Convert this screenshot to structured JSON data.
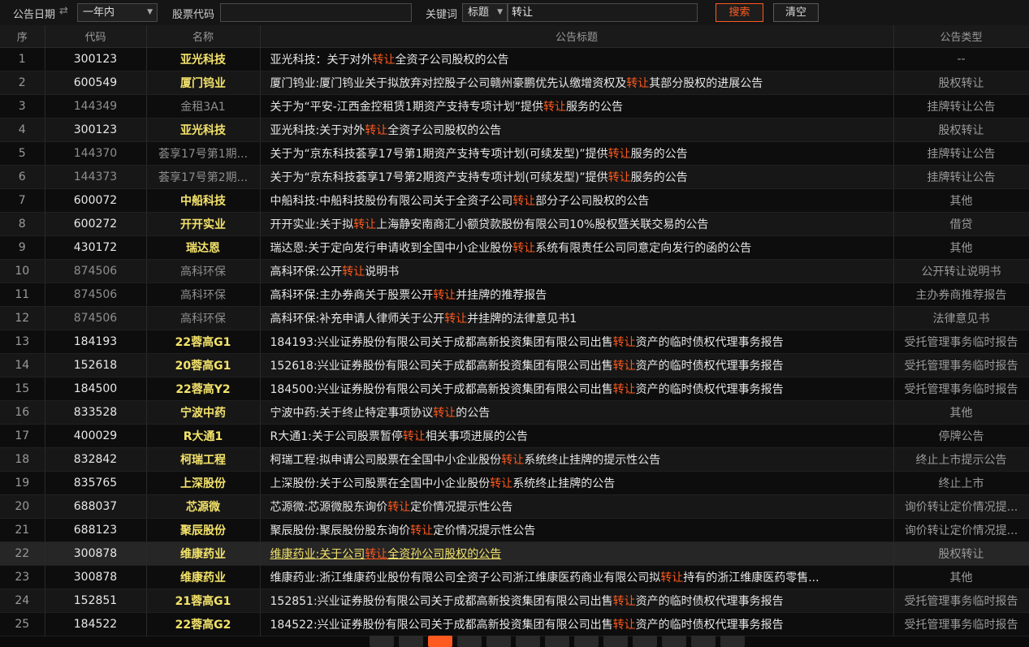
{
  "toolbar": {
    "date_label": "公告日期",
    "date_range": "一年内",
    "stock_code_label": "股票代码",
    "stock_code_value": "",
    "keyword_label": "关键词",
    "keyword_field": "标题",
    "keyword_value": "转让",
    "search_label": "搜索",
    "clear_label": "清空"
  },
  "columns": [
    "序",
    "代码",
    "名称",
    "公告标题",
    "公告类型"
  ],
  "rows": [
    {
      "idx": "1",
      "code": "300123",
      "name": "亚光科技",
      "pre": "亚光科技：关于对外",
      "hl": "转让",
      "post": "全资子公司股权的公告",
      "type": "--",
      "dim": false
    },
    {
      "idx": "2",
      "code": "600549",
      "name": "厦门钨业",
      "pre": "厦门钨业:厦门钨业关于拟放弃对控股子公司赣州豪鹏优先认缴增资权及",
      "hl": "转让",
      "post": "其部分股权的进展公告",
      "type": "股权转让",
      "dim": false
    },
    {
      "idx": "3",
      "code": "144349",
      "name": "金租3A1",
      "pre": "关于为“平安-江西金控租赁1期资产支持专项计划”提供",
      "hl": "转让",
      "post": "服务的公告",
      "type": "挂牌转让公告",
      "dim": true
    },
    {
      "idx": "4",
      "code": "300123",
      "name": "亚光科技",
      "pre": "亚光科技:关于对外",
      "hl": "转让",
      "post": "全资子公司股权的公告",
      "type": "股权转让",
      "dim": false
    },
    {
      "idx": "5",
      "code": "144370",
      "name": "荟享17号第1期...",
      "pre": "关于为“京东科技荟享17号第1期资产支持专项计划(可续发型)”提供",
      "hl": "转让",
      "post": "服务的公告",
      "type": "挂牌转让公告",
      "dim": true
    },
    {
      "idx": "6",
      "code": "144373",
      "name": "荟享17号第2期...",
      "pre": "关于为“京东科技荟享17号第2期资产支持专项计划(可续发型)”提供",
      "hl": "转让",
      "post": "服务的公告",
      "type": "挂牌转让公告",
      "dim": true
    },
    {
      "idx": "7",
      "code": "600072",
      "name": "中船科技",
      "pre": "中船科技:中船科技股份有限公司关于全资子公司",
      "hl": "转让",
      "post": "部分子公司股权的公告",
      "type": "其他",
      "dim": false
    },
    {
      "idx": "8",
      "code": "600272",
      "name": "开开实业",
      "pre": "开开实业:关于拟",
      "hl": "转让",
      "post": "上海静安南商汇小额贷款股份有限公司10%股权暨关联交易的公告",
      "type": "借贷",
      "dim": false
    },
    {
      "idx": "9",
      "code": "430172",
      "name": "瑞达恩",
      "pre": "瑞达恩:关于定向发行申请收到全国中小企业股份",
      "hl": "转让",
      "post": "系统有限责任公司同意定向发行的函的公告",
      "type": "其他",
      "dim": false
    },
    {
      "idx": "10",
      "code": "874506",
      "name": "高科环保",
      "pre": "高科环保:公开",
      "hl": "转让",
      "post": "说明书",
      "type": "公开转让说明书",
      "dim": true
    },
    {
      "idx": "11",
      "code": "874506",
      "name": "高科环保",
      "pre": "高科环保:主办券商关于股票公开",
      "hl": "转让",
      "post": "并挂牌的推荐报告",
      "type": "主办券商推荐报告",
      "dim": true
    },
    {
      "idx": "12",
      "code": "874506",
      "name": "高科环保",
      "pre": "高科环保:补充申请人律师关于公开",
      "hl": "转让",
      "post": "并挂牌的法律意见书1",
      "type": "法律意见书",
      "dim": true
    },
    {
      "idx": "13",
      "code": "184193",
      "name": "22蓉高G1",
      "pre": "184193:兴业证券股份有限公司关于成都高新投资集团有限公司出售",
      "hl": "转让",
      "post": "资产的临时债权代理事务报告",
      "type": "受托管理事务临时报告",
      "dim": false
    },
    {
      "idx": "14",
      "code": "152618",
      "name": "20蓉高G1",
      "pre": "152618:兴业证券股份有限公司关于成都高新投资集团有限公司出售",
      "hl": "转让",
      "post": "资产的临时债权代理事务报告",
      "type": "受托管理事务临时报告",
      "dim": false
    },
    {
      "idx": "15",
      "code": "184500",
      "name": "22蓉高Y2",
      "pre": "184500:兴业证券股份有限公司关于成都高新投资集团有限公司出售",
      "hl": "转让",
      "post": "资产的临时债权代理事务报告",
      "type": "受托管理事务临时报告",
      "dim": false
    },
    {
      "idx": "16",
      "code": "833528",
      "name": "宁波中药",
      "pre": "宁波中药:关于终止特定事项协议",
      "hl": "转让",
      "post": "的公告",
      "type": "其他",
      "dim": false
    },
    {
      "idx": "17",
      "code": "400029",
      "name": "R大通1",
      "pre": "R大通1:关于公司股票暂停",
      "hl": "转让",
      "post": "相关事项进展的公告",
      "type": "停牌公告",
      "dim": false
    },
    {
      "idx": "18",
      "code": "832842",
      "name": "柯瑞工程",
      "pre": "柯瑞工程:拟申请公司股票在全国中小企业股份",
      "hl": "转让",
      "post": "系统终止挂牌的提示性公告",
      "type": "终止上市提示公告",
      "dim": false
    },
    {
      "idx": "19",
      "code": "835765",
      "name": "上深股份",
      "pre": "上深股份:关于公司股票在全国中小企业股份",
      "hl": "转让",
      "post": "系统终止挂牌的公告",
      "type": "终止上市",
      "dim": false
    },
    {
      "idx": "20",
      "code": "688037",
      "name": "芯源微",
      "pre": "芯源微:芯源微股东询价",
      "hl": "转让",
      "post": "定价情况提示性公告",
      "type": "询价转让定价情况提...",
      "dim": false
    },
    {
      "idx": "21",
      "code": "688123",
      "name": "聚辰股份",
      "pre": "聚辰股份:聚辰股份股东询价",
      "hl": "转让",
      "post": "定价情况提示性公告",
      "type": "询价转让定价情况提...",
      "dim": false
    },
    {
      "idx": "22",
      "code": "300878",
      "name": "维康药业",
      "pre": "维康药业:关于公司",
      "hl": "转让",
      "post": "全资孙公司股权的公告",
      "type": "股权转让",
      "dim": false
    },
    {
      "idx": "23",
      "code": "300878",
      "name": "维康药业",
      "pre": "维康药业:浙江维康药业股份有限公司全资子公司浙江维康医药商业有限公司拟",
      "hl": "转让",
      "post": "持有的浙江维康医药零售...",
      "type": "其他",
      "dim": false
    },
    {
      "idx": "24",
      "code": "152851",
      "name": "21蓉高G1",
      "pre": "152851:兴业证券股份有限公司关于成都高新投资集团有限公司出售",
      "hl": "转让",
      "post": "资产的临时债权代理事务报告",
      "type": "受托管理事务临时报告",
      "dim": false
    },
    {
      "idx": "25",
      "code": "184522",
      "name": "22蓉高G2",
      "pre": "184522:兴业证券股份有限公司关于成都高新投资集团有限公司出售",
      "hl": "转让",
      "post": "资产的临时债权代理事务报告",
      "type": "受托管理事务临时报告",
      "dim": false
    }
  ],
  "selected_row": "22",
  "colors": {
    "accent": "#ff5a1f",
    "name_yellow": "#f4e36b",
    "background": "#0b0b0b"
  }
}
